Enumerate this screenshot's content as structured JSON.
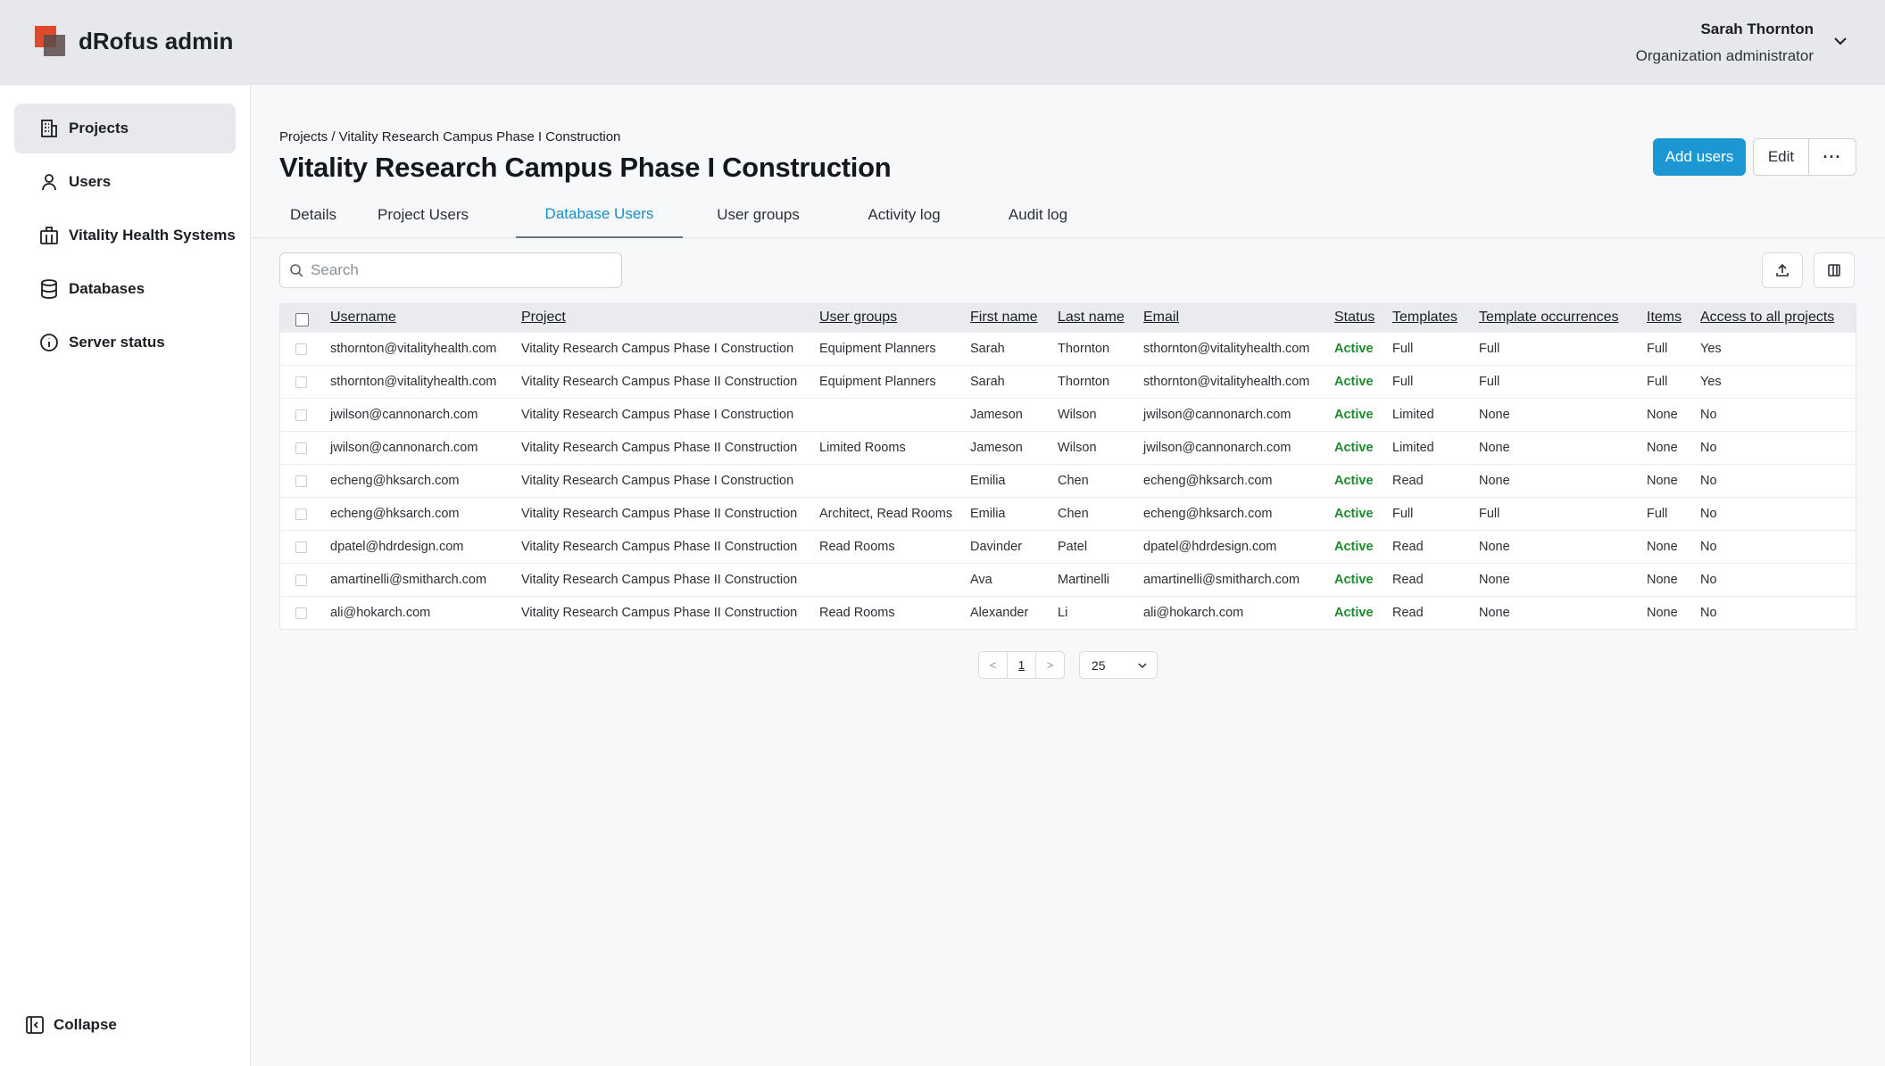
{
  "app": {
    "title": "dRofus admin"
  },
  "user": {
    "name": "Sarah Thornton",
    "role": "Organization administrator"
  },
  "sidebar": {
    "items": [
      {
        "label": "Projects",
        "icon": "building-icon",
        "active": true
      },
      {
        "label": "Users",
        "icon": "user-icon",
        "active": false
      },
      {
        "label": "Vitality Health Systems",
        "icon": "organization-icon",
        "active": false
      },
      {
        "label": "Databases",
        "icon": "database-icon",
        "active": false
      },
      {
        "label": "Server status",
        "icon": "info-icon",
        "active": false
      }
    ],
    "collapse_label": "Collapse"
  },
  "breadcrumb": "Projects / Vitality Research Campus Phase I Construction",
  "page_title": "Vitality Research Campus Phase I Construction",
  "actions": {
    "add_users": "Add users",
    "edit": "Edit",
    "more": "···"
  },
  "tabs": [
    {
      "label": "Details",
      "active": false
    },
    {
      "label": "Project Users",
      "active": false
    },
    {
      "label": "Database Users",
      "active": true
    },
    {
      "label": "User groups",
      "active": false
    },
    {
      "label": "Activity log",
      "active": false
    },
    {
      "label": "Audit log",
      "active": false
    }
  ],
  "search": {
    "placeholder": "Search",
    "value": ""
  },
  "table": {
    "columns": [
      "Username",
      "Project",
      "User groups",
      "First name",
      "Last name",
      "Email",
      "Status",
      "Templates",
      "Template occurrences",
      "Items",
      "Access to all projects"
    ],
    "rows": [
      [
        "sthornton@vitalityhealth.com",
        "Vitality Research Campus Phase I Construction",
        "Equipment Planners",
        "Sarah",
        "Thornton",
        "sthornton@vitalityhealth.com",
        "Active",
        "Full",
        "Full",
        "Full",
        "Yes"
      ],
      [
        "sthornton@vitalityhealth.com",
        "Vitality Research Campus Phase II Construction",
        "Equipment Planners",
        "Sarah",
        "Thornton",
        "sthornton@vitalityhealth.com",
        "Active",
        "Full",
        "Full",
        "Full",
        "Yes"
      ],
      [
        "jwilson@cannonarch.com",
        "Vitality Research Campus Phase I Construction",
        "",
        "Jameson",
        "Wilson",
        "jwilson@cannonarch.com",
        "Active",
        "Limited",
        "None",
        "None",
        "No"
      ],
      [
        "jwilson@cannonarch.com",
        "Vitality Research Campus Phase II Construction",
        "Limited Rooms",
        "Jameson",
        "Wilson",
        "jwilson@cannonarch.com",
        "Active",
        "Limited",
        "None",
        "None",
        "No"
      ],
      [
        "echeng@hksarch.com",
        "Vitality Research Campus Phase I Construction",
        "",
        "Emilia",
        "Chen",
        "echeng@hksarch.com",
        "Active",
        "Read",
        "None",
        "None",
        "No"
      ],
      [
        "echeng@hksarch.com",
        "Vitality Research Campus Phase II Construction",
        "Architect, Read Rooms",
        "Emilia",
        "Chen",
        "echeng@hksarch.com",
        "Active",
        "Full",
        "Full",
        "Full",
        "No"
      ],
      [
        "dpatel@hdrdesign.com",
        "Vitality Research Campus Phase II Construction",
        "Read Rooms",
        "Davinder",
        "Patel",
        "dpatel@hdrdesign.com",
        "Active",
        "Read",
        "None",
        "None",
        "No"
      ],
      [
        "amartinelli@smitharch.com",
        "Vitality Research Campus Phase II Construction",
        "",
        "Ava",
        "Martinelli",
        "amartinelli@smitharch.com",
        "Active",
        "Read",
        "None",
        "None",
        "No"
      ],
      [
        "ali@hokarch.com",
        "Vitality Research Campus Phase II Construction",
        "Read Rooms",
        "Alexander",
        "Li",
        "ali@hokarch.com",
        "Active",
        "Read",
        "None",
        "None",
        "No"
      ]
    ]
  },
  "pagination": {
    "prev": "<",
    "current_page": "1",
    "next": ">",
    "page_size": "25"
  },
  "colors": {
    "accent": "#1d97d4",
    "active_status": "#1e8a2e",
    "brand_red": "#e0492c"
  }
}
